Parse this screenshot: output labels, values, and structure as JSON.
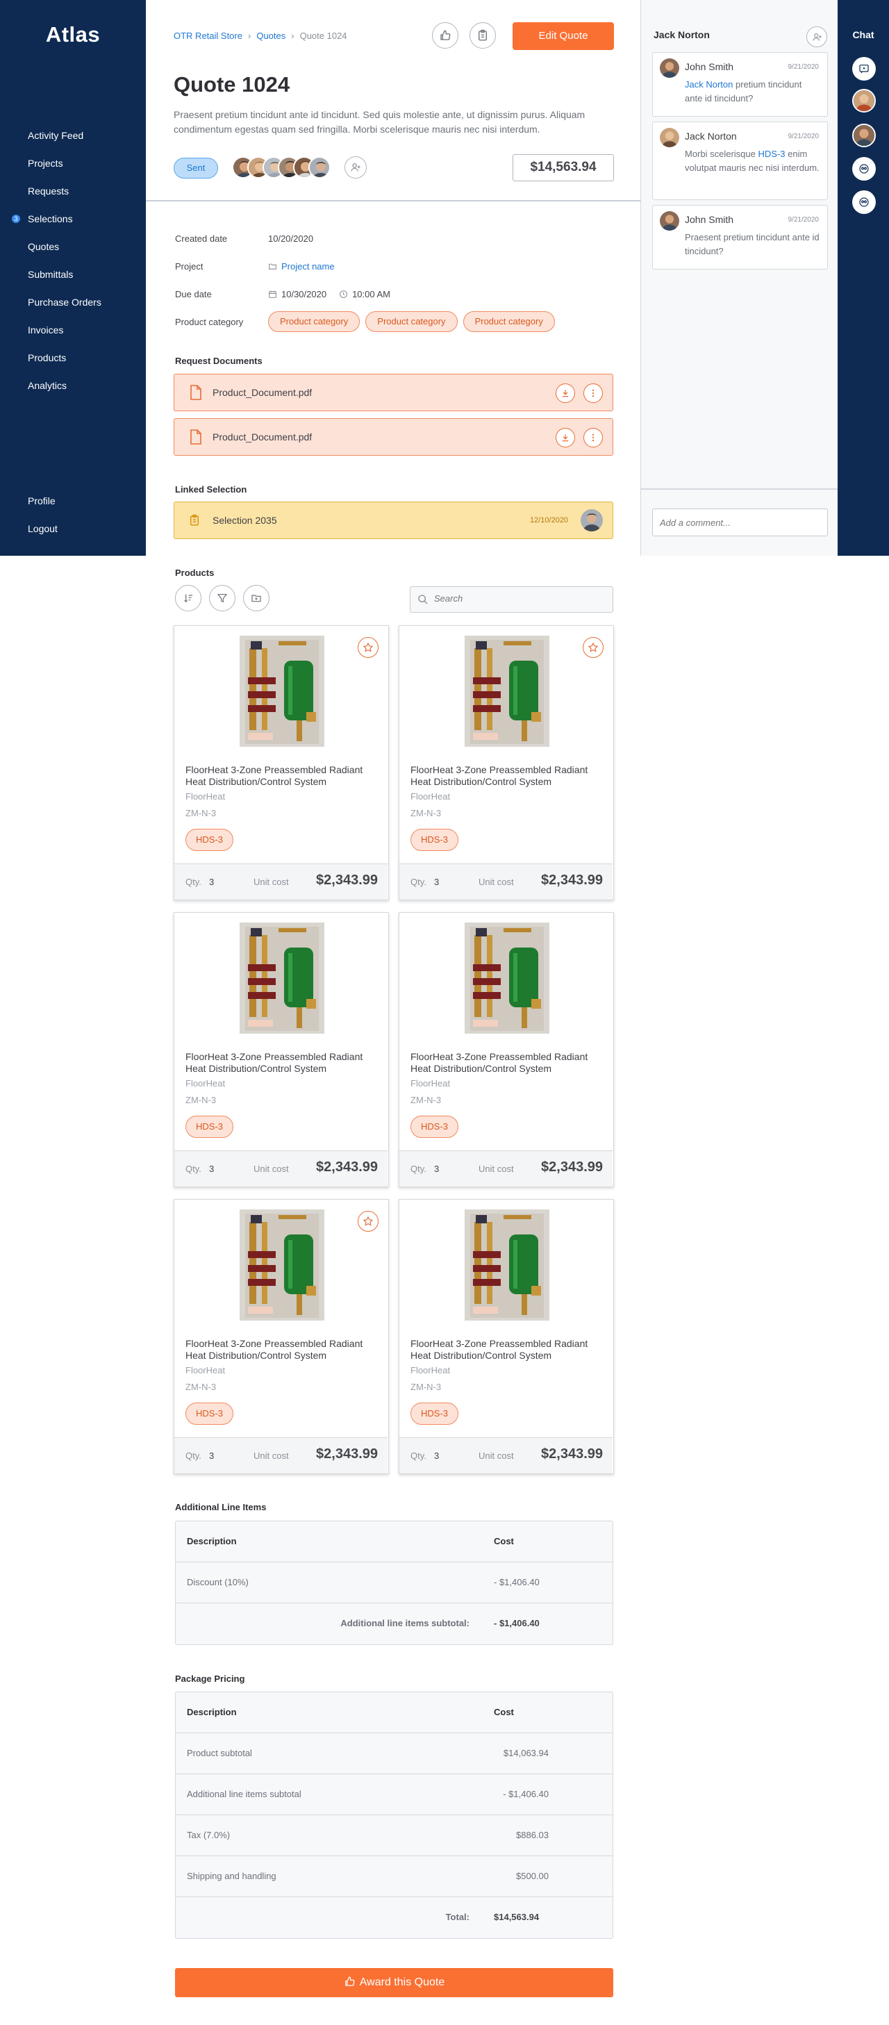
{
  "app": {
    "logo": "Atlas"
  },
  "sidebar": {
    "items": [
      {
        "label": "Activity Feed"
      },
      {
        "label": "Projects"
      },
      {
        "label": "Requests"
      },
      {
        "label": "Selections",
        "badge": "3"
      },
      {
        "label": "Quotes"
      },
      {
        "label": "Submittals"
      },
      {
        "label": "Purchase Orders"
      },
      {
        "label": "Invoices"
      },
      {
        "label": "Products"
      },
      {
        "label": "Analytics"
      }
    ],
    "bottom": [
      {
        "label": "Profile"
      },
      {
        "label": "Logout"
      }
    ]
  },
  "breadcrumb": {
    "root": "OTR Retail Store",
    "section": "Quotes",
    "current": "Quote 1024"
  },
  "header": {
    "edit_label": "Edit Quote",
    "title": "Quote 1024",
    "description": "Praesent pretium tincidunt ante id tincidunt. Sed quis molestie ante, ut dignissim purus. Aliquam condimentum egestas quam sed fringilla. Morbi scelerisque mauris nec nisi interdum.",
    "status": "Sent",
    "total": "$14,563.94"
  },
  "details": {
    "created_label": "Created date",
    "created_value": "10/20/2020",
    "project_label": "Project",
    "project_value": "Project name",
    "due_label": "Due date",
    "due_date": "10/30/2020",
    "due_time": "10:00 AM",
    "category_label": "Product category",
    "categories": [
      "Product category",
      "Product category",
      "Product category"
    ]
  },
  "documents": {
    "title": "Request Documents",
    "items": [
      {
        "name": "Product_Document.pdf"
      },
      {
        "name": "Product_Document.pdf"
      }
    ]
  },
  "linked": {
    "title": "Linked Selection",
    "name": "Selection 2035",
    "date": "12/10/2020"
  },
  "products": {
    "title": "Products",
    "search_placeholder": "Search",
    "qty_label": "Qty.",
    "unit_cost_label": "Unit cost",
    "items": [
      {
        "title": "FloorHeat 3-Zone Preassembled Radiant Heat Distribution/Control System",
        "brand": "FloorHeat",
        "model": "ZM-N-3",
        "tag": "HDS-3",
        "qty": "3",
        "price": "$2,343.99",
        "starred": true
      },
      {
        "title": "FloorHeat 3-Zone Preassembled Radiant Heat Distribution/Control System",
        "brand": "FloorHeat",
        "model": "ZM-N-3",
        "tag": "HDS-3",
        "qty": "3",
        "price": "$2,343.99",
        "starred": true
      },
      {
        "title": "FloorHeat 3-Zone Preassembled Radiant Heat Distribution/Control System",
        "brand": "FloorHeat",
        "model": "ZM-N-3",
        "tag": "HDS-3",
        "qty": "3",
        "price": "$2,343.99",
        "starred": false
      },
      {
        "title": "FloorHeat 3-Zone Preassembled Radiant Heat Distribution/Control System",
        "brand": "FloorHeat",
        "model": "ZM-N-3",
        "tag": "HDS-3",
        "qty": "3",
        "price": "$2,343.99",
        "starred": false
      },
      {
        "title": "FloorHeat 3-Zone Preassembled Radiant Heat Distribution/Control System",
        "brand": "FloorHeat",
        "model": "ZM-N-3",
        "tag": "HDS-3",
        "qty": "3",
        "price": "$2,343.99",
        "starred": true
      },
      {
        "title": "FloorHeat 3-Zone Preassembled Radiant Heat Distribution/Control System",
        "brand": "FloorHeat",
        "model": "ZM-N-3",
        "tag": "HDS-3",
        "qty": "3",
        "price": "$2,343.99",
        "starred": false
      }
    ]
  },
  "line_items": {
    "title": "Additional Line Items",
    "headers": [
      "Description",
      "Cost"
    ],
    "rows": [
      {
        "desc": "Discount (10%)",
        "cost": "- $1,406.40"
      }
    ],
    "subtotal_label": "Additional line items subtotal:",
    "subtotal_value": "- $1,406.40"
  },
  "pricing": {
    "title": "Package Pricing",
    "headers": [
      "Description",
      "Cost"
    ],
    "rows": [
      {
        "desc": "Product subtotal",
        "cost": "$14,063.94"
      },
      {
        "desc": "Additional line items subtotal",
        "cost": "- $1,406.40"
      },
      {
        "desc": "Tax (7.0%)",
        "cost": "$886.03"
      },
      {
        "desc": "Shipping and handling",
        "cost": "$500.00"
      }
    ],
    "total_label": "Total:",
    "total_value": "$14,563.94"
  },
  "award_label": "Award this Quote",
  "comments": {
    "header": "Jack Norton",
    "input_placeholder": "Add a comment...",
    "items": [
      {
        "author": "John Smith",
        "date": "9/21/2020",
        "mention": "Jack Norton",
        "text": " pretium tincidunt ante id tincidunt?"
      },
      {
        "author": "Jack Norton",
        "date": "9/21/2020",
        "pre": "Morbi scelerisque ",
        "mention": "HDS-3",
        "text": " enim volutpat mauris nec nisi interdum."
      },
      {
        "author": "John Smith",
        "date": "9/21/2020",
        "text": "Praesent pretium tincidunt ante id tincidunt?"
      }
    ]
  },
  "chat": {
    "title": "Chat"
  },
  "colors": {
    "navy": "#0e2a52",
    "accent": "#fa7033",
    "link": "#1f78d1",
    "status_bg": "#bcdcf9",
    "tag_bg": "#fde2d7",
    "linked_bg": "#fbe4a5"
  },
  "icons": [
    "thumbs-up-icon",
    "clipboard-icon",
    "add-user-icon",
    "folder-icon",
    "calendar-icon",
    "clock-icon",
    "pdf-file-icon",
    "download-icon",
    "more-icon",
    "sort-icon",
    "filter-icon",
    "folder-plus-icon",
    "search-icon",
    "star-icon",
    "chat-bubble-icon",
    "group-icon"
  ]
}
